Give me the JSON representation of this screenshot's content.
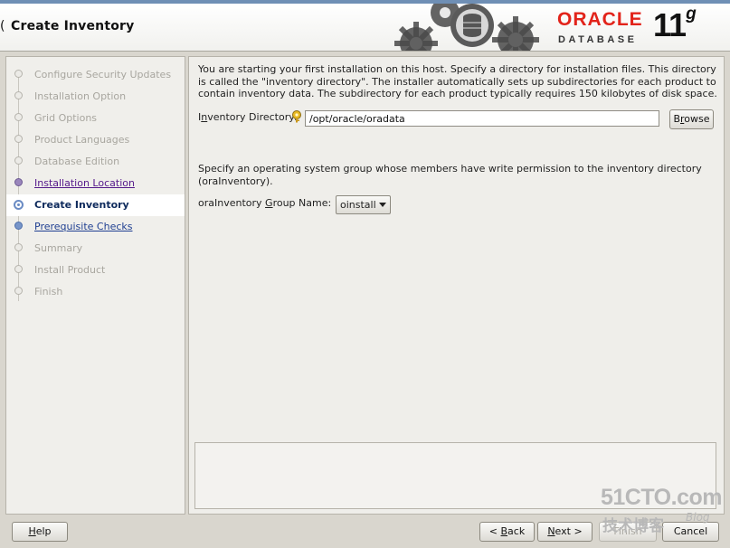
{
  "window": {
    "title": "Create Inventory",
    "left_edge_char": "("
  },
  "branding": {
    "company": "ORACLE",
    "product": "DATABASE",
    "version_number": "11",
    "version_letter": "g"
  },
  "steps": [
    {
      "label": "Configure Security Updates",
      "state": "disabled"
    },
    {
      "label": "Installation Option",
      "state": "disabled"
    },
    {
      "label": "Grid Options",
      "state": "disabled"
    },
    {
      "label": "Product Languages",
      "state": "disabled"
    },
    {
      "label": "Database Edition",
      "state": "disabled"
    },
    {
      "label": "Installation Location",
      "state": "visited"
    },
    {
      "label": "Create Inventory",
      "state": "current"
    },
    {
      "label": "Prerequisite Checks",
      "state": "next"
    },
    {
      "label": "Summary",
      "state": "disabled"
    },
    {
      "label": "Install Product",
      "state": "disabled"
    },
    {
      "label": "Finish",
      "state": "disabled"
    }
  ],
  "main": {
    "intro_line1": "You are starting your first installation on this host. Specify a directory for installation files. This directory",
    "intro_line2": "is called the \"inventory directory\". The installer automatically sets up subdirectories for each product to",
    "intro_line3": "contain inventory data. The subdirectory for each product typically requires 150 kilobytes of disk space.",
    "inventory_dir_label_pre": "I",
    "inventory_dir_label_ul": "n",
    "inventory_dir_label_post": "ventory Directory:",
    "inventory_dir_value": "/opt/oracle/oradata",
    "browse_pre": "B",
    "browse_ul": "r",
    "browse_post": "owse",
    "group_line1": "Specify an operating system group whose members have write permission to the inventory directory",
    "group_line2": "(oraInventory).",
    "group_label_pre": "oraInventory ",
    "group_label_ul": "G",
    "group_label_post": "roup Name:",
    "group_value": "oinstall"
  },
  "footer": {
    "help_pre": "",
    "help_ul": "H",
    "help_post": "elp",
    "back_pre": "< ",
    "back_ul": "B",
    "back_post": "ack",
    "next_pre": "",
    "next_ul": "N",
    "next_post": "ext >",
    "finish_label": "Finish",
    "cancel_label": "Cancel"
  },
  "watermark": {
    "main": "51CTO.com",
    "sub": "技术博客",
    "blog": "Blog"
  },
  "colors": {
    "oracle_red": "#e2231a",
    "visited_link": "#551a8b",
    "next_link": "#1f3f91",
    "current_step": "#0e2a5c"
  }
}
